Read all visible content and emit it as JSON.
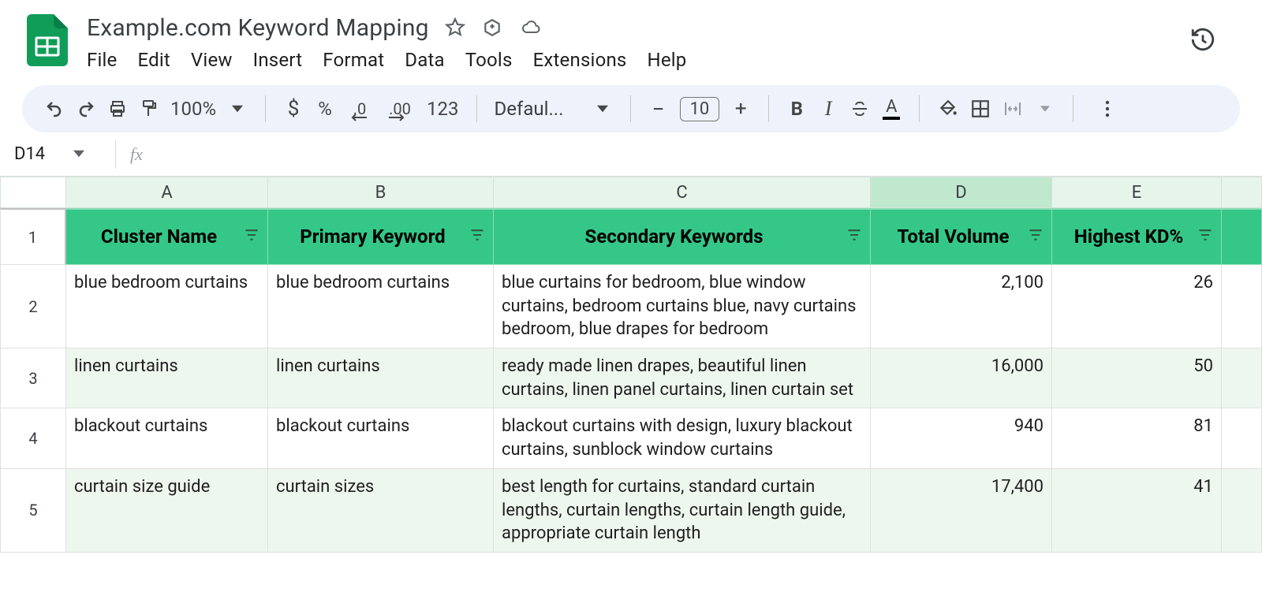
{
  "doc": {
    "title": "Example.com Keyword Mapping"
  },
  "menus": {
    "file": "File",
    "edit": "Edit",
    "view": "View",
    "insert": "Insert",
    "format": "Format",
    "data": "Data",
    "tools": "Tools",
    "extensions": "Extensions",
    "help": "Help"
  },
  "toolbar": {
    "zoom": "100%",
    "currency": "$",
    "percent": "%",
    "dec_dec": ".0",
    "dec_inc": ".00",
    "num_fmt": "123",
    "font": "Defaul...",
    "font_size": "10"
  },
  "namebox": {
    "ref": "D14",
    "fx": "fx"
  },
  "columns": {
    "A": "A",
    "B": "B",
    "C": "C",
    "D": "D",
    "E": "E"
  },
  "headers": {
    "A": "Cluster Name",
    "B": "Primary Keyword",
    "C": "Secondary Keywords",
    "D": "Total Volume",
    "E": "Highest KD%"
  },
  "rows": [
    {
      "num": "2",
      "A": "blue bedroom curtains",
      "B": "blue bedroom curtains",
      "C": "blue curtains for bedroom, blue window curtains, bedroom curtains blue, navy curtains bedroom, blue drapes for bedroom",
      "D": "2,100",
      "E": "26"
    },
    {
      "num": "3",
      "A": "linen curtains",
      "B": "linen curtains",
      "C": "ready made linen drapes, beautiful linen curtains, linen panel curtains, linen curtain set",
      "D": "16,000",
      "E": "50"
    },
    {
      "num": "4",
      "A": "blackout curtains",
      "B": "blackout curtains",
      "C": "blackout curtains with design, luxury blackout curtains, sunblock window curtains",
      "D": "940",
      "E": "81"
    },
    {
      "num": "5",
      "A": "curtain size guide",
      "B": "curtain sizes",
      "C": "best length for curtains, standard curtain lengths, curtain lengths, curtain length guide, appropriate curtain length",
      "D": "17,400",
      "E": "41"
    }
  ],
  "row1num": "1"
}
